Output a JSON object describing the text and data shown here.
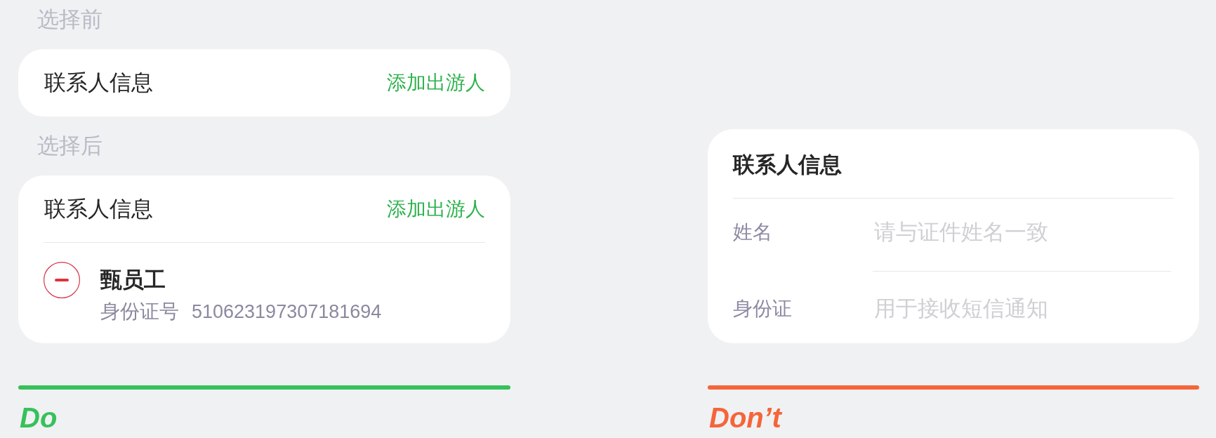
{
  "panels": [
    {
      "color": "#36c15b",
      "sections": [
        {
          "label": "选择前",
          "card": {
            "title": "联系人信息",
            "action": "添加出游人"
          }
        },
        {
          "label": "选择后",
          "card": {
            "title": "联系人信息",
            "action": "添加出游人",
            "travelers": [
              {
                "name": "甄员工",
                "id_label": "身份证号",
                "id_number": "510623197307181694"
              }
            ]
          }
        }
      ],
      "verdict": "Do"
    },
    {
      "color": "#f5653a",
      "form": {
        "title": "联系人信息",
        "fields": [
          {
            "label": "姓名",
            "placeholder": "请与证件姓名一致"
          },
          {
            "label": "身份证",
            "placeholder": "用于接收短信通知"
          }
        ]
      },
      "verdict": "Don’t"
    }
  ]
}
